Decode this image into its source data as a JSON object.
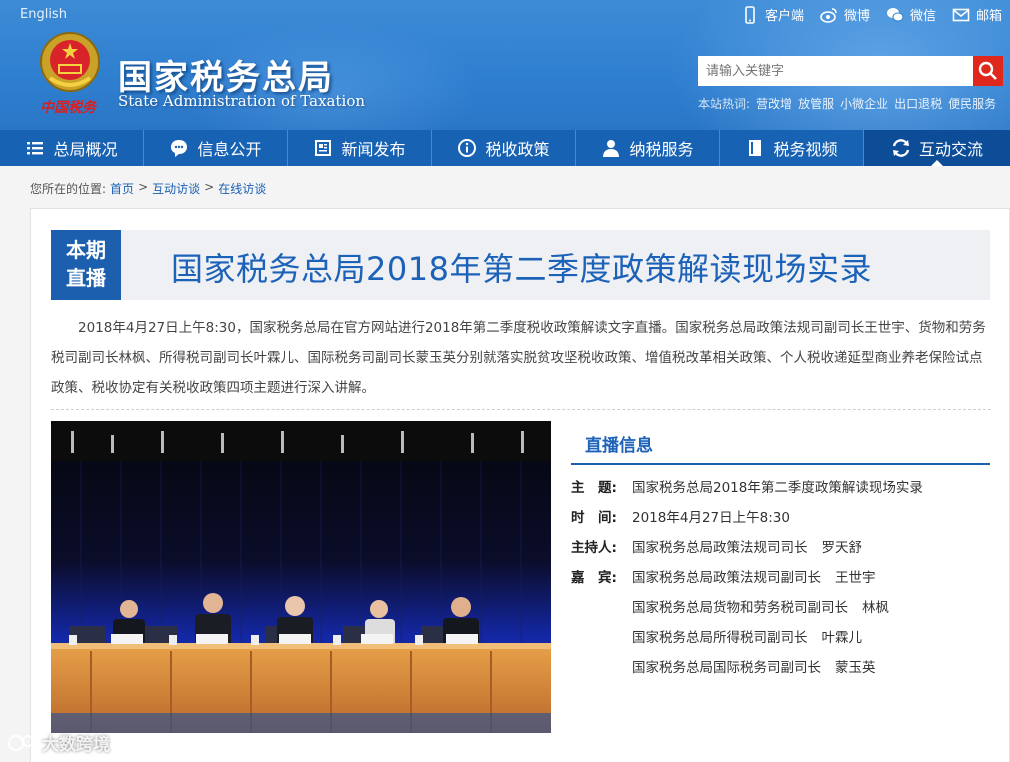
{
  "header": {
    "lang_link": "English",
    "title": "国家税务总局",
    "title_en": "State Administration of Taxation",
    "logo_text": "中国税务",
    "top_links": [
      {
        "label": "客户端",
        "icon": "phone-icon"
      },
      {
        "label": "微博",
        "icon": "weibo-icon"
      },
      {
        "label": "微信",
        "icon": "wechat-icon"
      },
      {
        "label": "邮箱",
        "icon": "mail-icon"
      }
    ],
    "search": {
      "placeholder": "请输入关键字",
      "value": ""
    },
    "hot_label": "本站热词:",
    "hot_words": [
      "营改增",
      "放管服",
      "小微企业",
      "出口退税",
      "便民服务"
    ]
  },
  "nav": {
    "items": [
      {
        "label": "总局概况",
        "icon": "menu-icon"
      },
      {
        "label": "信息公开",
        "icon": "chat-icon"
      },
      {
        "label": "新闻发布",
        "icon": "newspaper-icon"
      },
      {
        "label": "税收政策",
        "icon": "info-icon"
      },
      {
        "label": "纳税服务",
        "icon": "user-icon"
      },
      {
        "label": "税务视频",
        "icon": "film-icon"
      },
      {
        "label": "互动交流",
        "icon": "exchange-icon"
      }
    ],
    "active_index": 6
  },
  "breadcrumb": {
    "prefix": "您所在的位置:",
    "items": [
      "首页",
      "互动访谈",
      "在线访谈"
    ],
    "separator": ">"
  },
  "main": {
    "badge_line1": "本期",
    "badge_line2": "直播",
    "title": "国家税务总局2018年第二季度政策解读现场实录",
    "intro": "2018年4月27日上午8:30，国家税务总局在官方网站进行2018年第二季度税收政策解读文字直播。国家税务总局政策法规司副司长王世宇、货物和劳务税司副司长林枫、所得税司副司长叶霖儿、国际税务司副司长蒙玉英分别就落实脱贫攻坚税收政策、增值税改革相关政策、个人税收递延型商业养老保险试点政策、税收协定有关税收政策四项主题进行深入讲解。",
    "info_heading": "直播信息",
    "info": {
      "topic_key": "主　题:",
      "topic_val": "国家税务总局2018年第二季度政策解读现场实录",
      "time_key": "时　间:",
      "time_val": "2018年4月27日上午8:30",
      "host_key": "主持人:",
      "host_org": "国家税务总局政策法规司司长",
      "host_name": "罗天舒",
      "guest_key": "嘉　宾:",
      "guests": [
        {
          "org": "国家税务总局政策法规司副司长",
          "name": "王世宇"
        },
        {
          "org": "国家税务总局货物和劳务税司副司长",
          "name": "林枫"
        },
        {
          "org": "国家税务总局所得税司副司长",
          "name": "叶霖儿"
        },
        {
          "org": "国家税务总局国际税务司副司长",
          "name": "蒙玉英"
        }
      ]
    }
  },
  "watermark": "大数跨境",
  "colors": {
    "nav": "#1862b4",
    "nav_active": "#0d4c97",
    "accent_red": "#e0271b",
    "title_blue": "#1c62b8"
  }
}
